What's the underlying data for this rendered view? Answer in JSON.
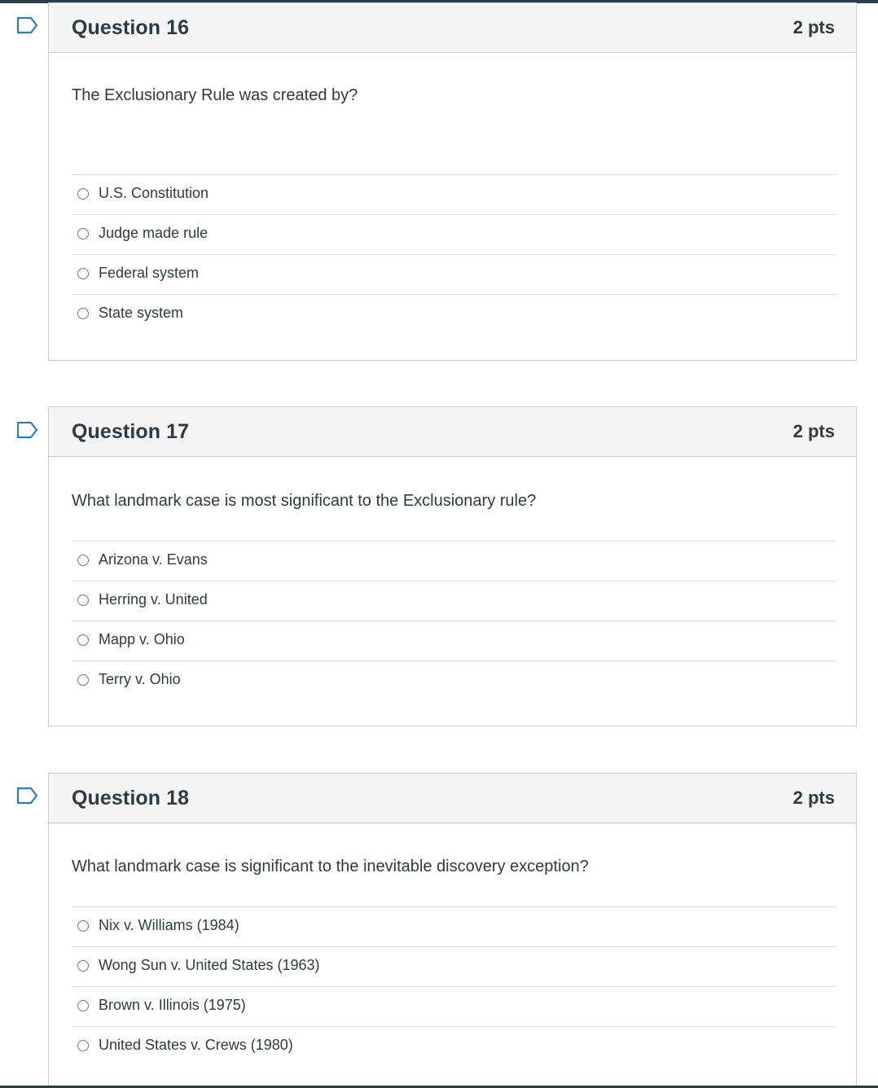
{
  "questions": [
    {
      "title": "Question 16",
      "points": "2 pts",
      "text": "The Exclusionary Rule was created by?",
      "answers": [
        "U.S. Constitution",
        "Judge made rule",
        "Federal system",
        "State system"
      ]
    },
    {
      "title": "Question 17",
      "points": "2 pts",
      "text": "What landmark case is most significant to the Exclusionary rule?",
      "answers": [
        "Arizona v. Evans",
        "Herring v. United",
        "Mapp v. Ohio",
        "Terry v. Ohio"
      ]
    },
    {
      "title": "Question 18",
      "points": "2 pts",
      "text": "What landmark case is significant to the inevitable discovery exception?",
      "answers": [
        "Nix v. Williams (1984)",
        "Wong Sun v. United States (1963)",
        "Brown v. Illinois (1975)",
        "United States v. Crews (1980)"
      ]
    }
  ],
  "icons": {
    "flag": "bookmark-flag-icon",
    "radio": "radio-unchecked-icon"
  },
  "colors": {
    "text": "#2d3b45",
    "header_bg": "#f5f5f5",
    "border": "#c7cdd1",
    "flag": "#2b7abc"
  }
}
